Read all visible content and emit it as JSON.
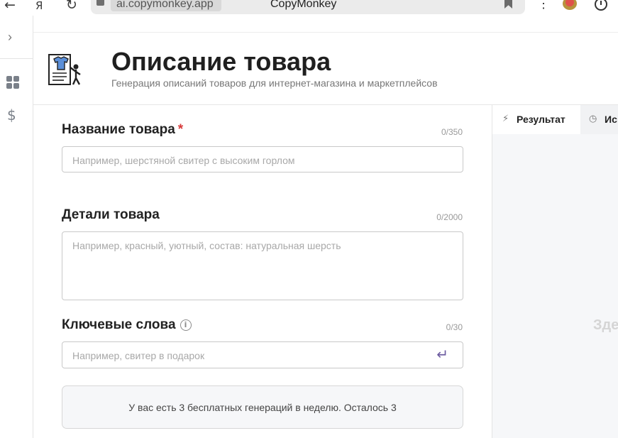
{
  "browser": {
    "url": "ai.copymonkey.app",
    "page_name": "CopyMonkey",
    "back_icon": "arrow-left-icon",
    "yandex_icon": "yandex-icon",
    "reload_icon": "reload-icon"
  },
  "sidebar": {
    "toggle_icon": "chevron-right-icon",
    "items": [
      {
        "icon": "grid-icon"
      },
      {
        "icon": "dollar-icon"
      }
    ]
  },
  "header": {
    "title": "Описание товара",
    "subtitle": "Генерация описаний товаров для интернет-магазина и маркетплейсов"
  },
  "form": {
    "product_name": {
      "label": "Название товара",
      "required_mark": "*",
      "counter": "0/350",
      "placeholder": "Например, шерстяной свитер с высоким горлом"
    },
    "product_details": {
      "label": "Детали товара",
      "counter": "0/2000",
      "placeholder": "Например, красный, уютный, состав: натуральная шерсть"
    },
    "keywords": {
      "label": "Ключевые слова",
      "counter": "0/30",
      "placeholder": "Например, свитер в подарок"
    },
    "notice": "У вас есть 3 бесплатных генераций в неделю. Осталось 3"
  },
  "result_panel": {
    "tabs": [
      {
        "label": "Результат",
        "icon": "lightning-icon",
        "active": true
      },
      {
        "label": "Ис",
        "icon": "clock-icon",
        "active": false
      }
    ],
    "placeholder": "Зде"
  },
  "colors": {
    "accent": "#6c5ba0",
    "required": "#d73a3a",
    "panel_bg": "#f6f7f9"
  }
}
